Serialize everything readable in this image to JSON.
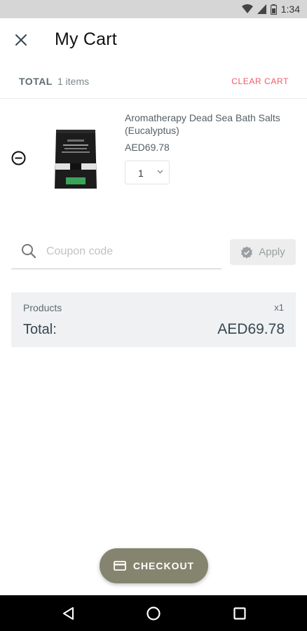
{
  "status_bar": {
    "time": "1:34",
    "icons": [
      "wifi-icon",
      "cell-signal-icon",
      "battery-icon"
    ]
  },
  "header": {
    "title": "My Cart",
    "close_icon": "close-icon"
  },
  "summary": {
    "total_label": "TOTAL",
    "items_count": "1 items",
    "clear_cart_label": "CLEAR CART"
  },
  "cart": {
    "items": [
      {
        "name": "Aromatherapy Dead Sea Bath Salts (Eucalyptus)",
        "price": "AED69.78",
        "quantity": "1",
        "remove_icon": "minus-circle-icon"
      }
    ]
  },
  "coupon": {
    "placeholder": "Coupon code",
    "value": "",
    "apply_label": "Apply"
  },
  "totals": {
    "products_label": "Products",
    "products_qty": "x1",
    "total_label": "Total:",
    "total_amount": "AED69.78"
  },
  "checkout": {
    "label": "CHECKOUT",
    "icon": "credit-card-icon"
  },
  "nav": {
    "buttons": [
      "back-icon",
      "home-icon",
      "recents-icon"
    ]
  },
  "colors": {
    "accent": "#85856f",
    "clear_cart": "#f0596a",
    "totals_bg": "#eff1f2"
  }
}
